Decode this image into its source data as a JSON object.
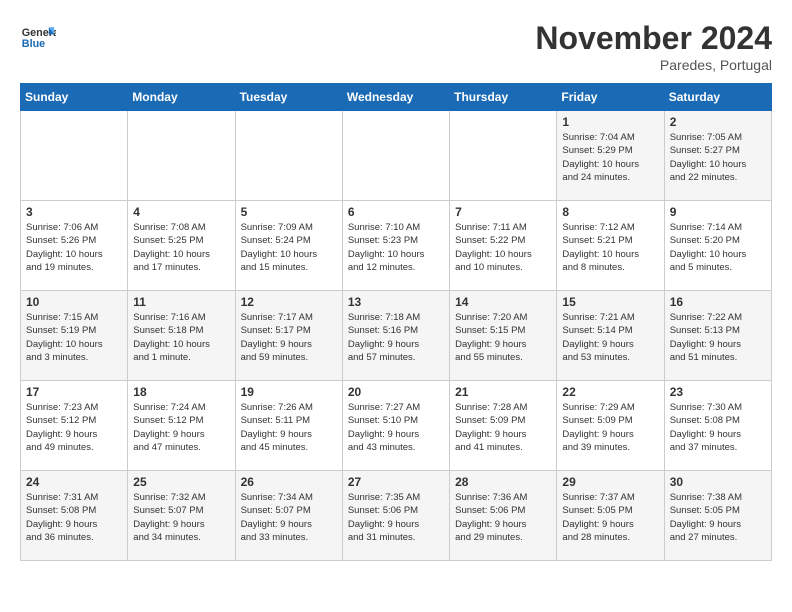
{
  "logo": {
    "general": "General",
    "blue": "Blue"
  },
  "title": "November 2024",
  "subtitle": "Paredes, Portugal",
  "days_of_week": [
    "Sunday",
    "Monday",
    "Tuesday",
    "Wednesday",
    "Thursday",
    "Friday",
    "Saturday"
  ],
  "weeks": [
    [
      {
        "day": "",
        "info": ""
      },
      {
        "day": "",
        "info": ""
      },
      {
        "day": "",
        "info": ""
      },
      {
        "day": "",
        "info": ""
      },
      {
        "day": "",
        "info": ""
      },
      {
        "day": "1",
        "info": "Sunrise: 7:04 AM\nSunset: 5:29 PM\nDaylight: 10 hours\nand 24 minutes."
      },
      {
        "day": "2",
        "info": "Sunrise: 7:05 AM\nSunset: 5:27 PM\nDaylight: 10 hours\nand 22 minutes."
      }
    ],
    [
      {
        "day": "3",
        "info": "Sunrise: 7:06 AM\nSunset: 5:26 PM\nDaylight: 10 hours\nand 19 minutes."
      },
      {
        "day": "4",
        "info": "Sunrise: 7:08 AM\nSunset: 5:25 PM\nDaylight: 10 hours\nand 17 minutes."
      },
      {
        "day": "5",
        "info": "Sunrise: 7:09 AM\nSunset: 5:24 PM\nDaylight: 10 hours\nand 15 minutes."
      },
      {
        "day": "6",
        "info": "Sunrise: 7:10 AM\nSunset: 5:23 PM\nDaylight: 10 hours\nand 12 minutes."
      },
      {
        "day": "7",
        "info": "Sunrise: 7:11 AM\nSunset: 5:22 PM\nDaylight: 10 hours\nand 10 minutes."
      },
      {
        "day": "8",
        "info": "Sunrise: 7:12 AM\nSunset: 5:21 PM\nDaylight: 10 hours\nand 8 minutes."
      },
      {
        "day": "9",
        "info": "Sunrise: 7:14 AM\nSunset: 5:20 PM\nDaylight: 10 hours\nand 5 minutes."
      }
    ],
    [
      {
        "day": "10",
        "info": "Sunrise: 7:15 AM\nSunset: 5:19 PM\nDaylight: 10 hours\nand 3 minutes."
      },
      {
        "day": "11",
        "info": "Sunrise: 7:16 AM\nSunset: 5:18 PM\nDaylight: 10 hours\nand 1 minute."
      },
      {
        "day": "12",
        "info": "Sunrise: 7:17 AM\nSunset: 5:17 PM\nDaylight: 9 hours\nand 59 minutes."
      },
      {
        "day": "13",
        "info": "Sunrise: 7:18 AM\nSunset: 5:16 PM\nDaylight: 9 hours\nand 57 minutes."
      },
      {
        "day": "14",
        "info": "Sunrise: 7:20 AM\nSunset: 5:15 PM\nDaylight: 9 hours\nand 55 minutes."
      },
      {
        "day": "15",
        "info": "Sunrise: 7:21 AM\nSunset: 5:14 PM\nDaylight: 9 hours\nand 53 minutes."
      },
      {
        "day": "16",
        "info": "Sunrise: 7:22 AM\nSunset: 5:13 PM\nDaylight: 9 hours\nand 51 minutes."
      }
    ],
    [
      {
        "day": "17",
        "info": "Sunrise: 7:23 AM\nSunset: 5:12 PM\nDaylight: 9 hours\nand 49 minutes."
      },
      {
        "day": "18",
        "info": "Sunrise: 7:24 AM\nSunset: 5:12 PM\nDaylight: 9 hours\nand 47 minutes."
      },
      {
        "day": "19",
        "info": "Sunrise: 7:26 AM\nSunset: 5:11 PM\nDaylight: 9 hours\nand 45 minutes."
      },
      {
        "day": "20",
        "info": "Sunrise: 7:27 AM\nSunset: 5:10 PM\nDaylight: 9 hours\nand 43 minutes."
      },
      {
        "day": "21",
        "info": "Sunrise: 7:28 AM\nSunset: 5:09 PM\nDaylight: 9 hours\nand 41 minutes."
      },
      {
        "day": "22",
        "info": "Sunrise: 7:29 AM\nSunset: 5:09 PM\nDaylight: 9 hours\nand 39 minutes."
      },
      {
        "day": "23",
        "info": "Sunrise: 7:30 AM\nSunset: 5:08 PM\nDaylight: 9 hours\nand 37 minutes."
      }
    ],
    [
      {
        "day": "24",
        "info": "Sunrise: 7:31 AM\nSunset: 5:08 PM\nDaylight: 9 hours\nand 36 minutes."
      },
      {
        "day": "25",
        "info": "Sunrise: 7:32 AM\nSunset: 5:07 PM\nDaylight: 9 hours\nand 34 minutes."
      },
      {
        "day": "26",
        "info": "Sunrise: 7:34 AM\nSunset: 5:07 PM\nDaylight: 9 hours\nand 33 minutes."
      },
      {
        "day": "27",
        "info": "Sunrise: 7:35 AM\nSunset: 5:06 PM\nDaylight: 9 hours\nand 31 minutes."
      },
      {
        "day": "28",
        "info": "Sunrise: 7:36 AM\nSunset: 5:06 PM\nDaylight: 9 hours\nand 29 minutes."
      },
      {
        "day": "29",
        "info": "Sunrise: 7:37 AM\nSunset: 5:05 PM\nDaylight: 9 hours\nand 28 minutes."
      },
      {
        "day": "30",
        "info": "Sunrise: 7:38 AM\nSunset: 5:05 PM\nDaylight: 9 hours\nand 27 minutes."
      }
    ]
  ]
}
